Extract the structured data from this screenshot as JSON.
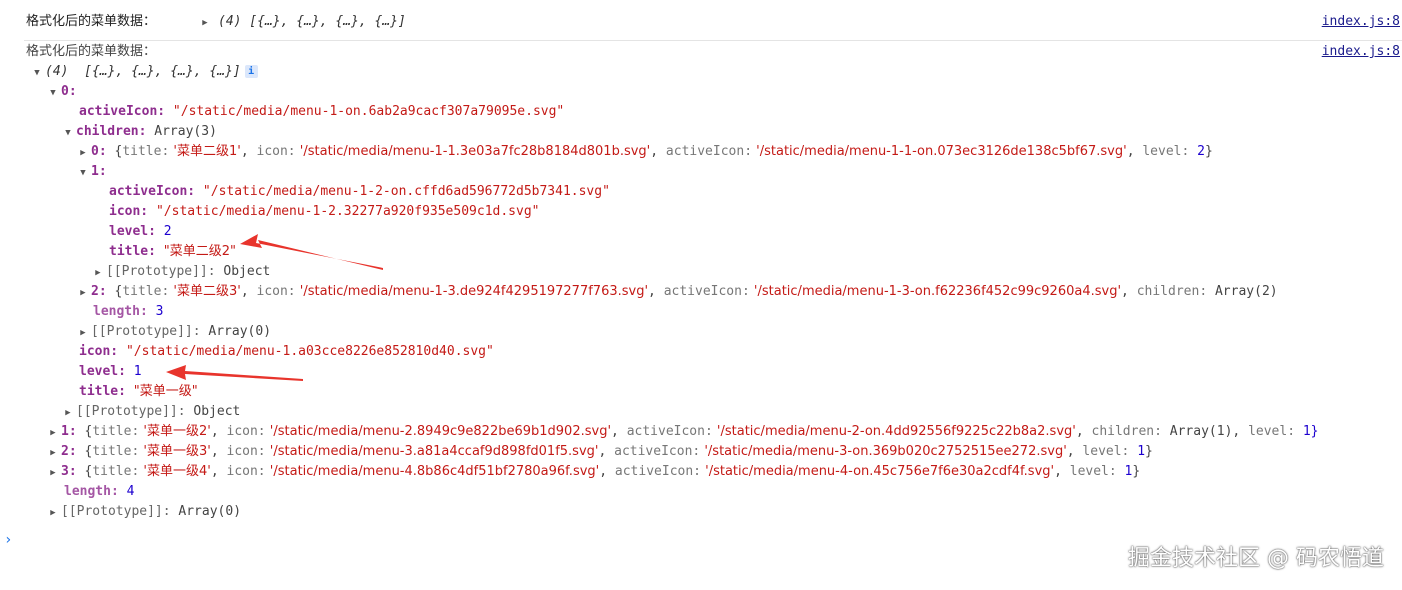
{
  "log1": {
    "label": "格式化后的菜单数据：",
    "preview": "(4)  [{…},  {…},  {…},  {…}]",
    "source": "index.js:8"
  },
  "log2": {
    "label": "格式化后的菜单数据：",
    "source": "index.js:8"
  },
  "root": {
    "count": "(4)",
    "preview": "[{…},  {…},  {…},  {…}]",
    "info": "i"
  },
  "item0": {
    "key": "0:",
    "activeIcon_key": "activeIcon:",
    "activeIcon_val": "\"/static/media/menu-1-on.6ab2a9cacf307a79095e.svg\"",
    "children_key": "children:",
    "children_val": "Array(3)",
    "children": {
      "c0_key": "0:",
      "c0_parts": [
        "{",
        "title:",
        " '菜单二级1'",
        ", ",
        "icon:",
        " '/static/media/menu-1-1.3e03a7fc28b8184d801b.svg'",
        ", ",
        "activeIcon:",
        " '/static/media/menu-1-1-on.073ec3126de138c5bf67.svg'",
        ", ",
        "level:",
        " 2",
        "}"
      ],
      "c1_key": "1:",
      "c1": {
        "activeIcon_key": "activeIcon:",
        "activeIcon_val": "\"/static/media/menu-1-2-on.cffd6ad596772d5b7341.svg\"",
        "icon_key": "icon:",
        "icon_val": "\"/static/media/menu-1-2.32277a920f935e509c1d.svg\"",
        "level_key": "level:",
        "level_val": "2",
        "title_key": "title:",
        "title_val": "\"菜单二级2\"",
        "proto_key": "[[Prototype]]:",
        "proto_val": "Object"
      },
      "c2_key": "2:",
      "c2_parts": [
        "{",
        "title:",
        " '菜单二级3'",
        ", ",
        "icon:",
        " '/static/media/menu-1-3.de924f4295197277f763.svg'",
        ", ",
        "activeIcon:",
        " '/static/media/menu-1-3-on.f62236f452c99c9260a4.svg'",
        ", ",
        "children:",
        " Array(2)"
      ],
      "length_key": "length:",
      "length_val": "3",
      "proto_key": "[[Prototype]]:",
      "proto_val": "Array(0)"
    },
    "icon_key": "icon:",
    "icon_val": "\"/static/media/menu-1.a03cce8226e852810d40.svg\"",
    "level_key": "level:",
    "level_val": "1",
    "title_key": "title:",
    "title_val": "\"菜单一级\"",
    "proto_key": "[[Prototype]]:",
    "proto_val": "Object"
  },
  "item1": {
    "key": "1:",
    "parts": [
      "{",
      "title:",
      " '菜单一级2'",
      ", ",
      "icon:",
      " '/static/media/menu-2.8949c9e822be69b1d902.svg'",
      ", ",
      "activeIcon:",
      " '/static/media/menu-2-on.4dd92556f9225c22b8a2.svg'",
      ", ",
      "children:",
      " Array(1)",
      ", ",
      "level:",
      " 1}"
    ]
  },
  "item2": {
    "key": "2:",
    "parts": [
      "{",
      "title:",
      " '菜单一级3'",
      ", ",
      "icon:",
      " '/static/media/menu-3.a81a4ccaf9d898fd01f5.svg'",
      ", ",
      "activeIcon:",
      " '/static/media/menu-3-on.369b020c2752515ee272.svg'",
      ", ",
      "level:",
      " 1",
      "}"
    ]
  },
  "item3": {
    "key": "3:",
    "parts": [
      "{",
      "title:",
      " '菜单一级4'",
      ", ",
      "icon:",
      " '/static/media/menu-4.8b86c4df51bf2780a96f.svg'",
      ", ",
      "activeIcon:",
      " '/static/media/menu-4-on.45c756e7f6e30a2cdf4f.svg'",
      ", ",
      "level:",
      " 1",
      "}"
    ]
  },
  "root_length_key": "length:",
  "root_length_val": "4",
  "root_proto_key": "[[Prototype]]:",
  "root_proto_val": "Array(0)",
  "watermark": "掘金技术社区 @ 码农悟道",
  "colors": {
    "key": "#8e2d8e",
    "string": "#c41a16",
    "number": "#1c00cf",
    "arrow": "#e8342c"
  }
}
